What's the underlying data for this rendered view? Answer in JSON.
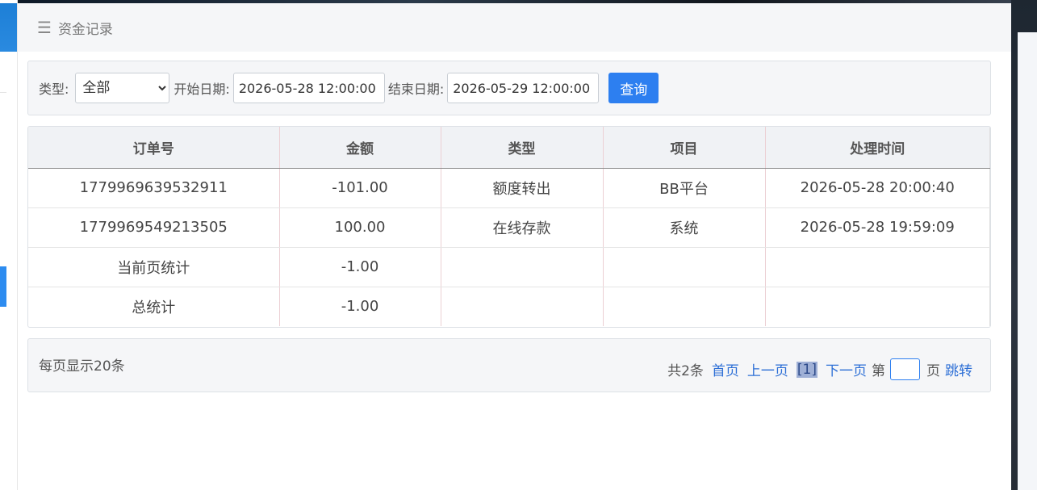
{
  "header": {
    "title": "资金记录",
    "icon": "menu-icon"
  },
  "filter": {
    "type_label": "类型:",
    "type_value": "全部",
    "start_label": "开始日期:",
    "start_value": "2026-05-28 12:00:00",
    "end_label": "结束日期:",
    "end_value": "2026-05-29 12:00:00",
    "query_label": "查询"
  },
  "table": {
    "headers": [
      "订单号",
      "金额",
      "类型",
      "项目",
      "处理时间"
    ],
    "rows": [
      [
        "1779969639532911",
        "-101.00",
        "额度转出",
        "BB平台",
        "2026-05-28 20:00:40"
      ],
      [
        "1779969549213505",
        "100.00",
        "在线存款",
        "系统",
        "2026-05-28 19:59:09"
      ],
      [
        "当前页统计",
        "-1.00",
        "",
        "",
        ""
      ],
      [
        "总统计",
        "-1.00",
        "",
        "",
        ""
      ]
    ]
  },
  "pager": {
    "page_size": "每页显示20条",
    "total": "共2条",
    "first": "首页",
    "prev": "上一页",
    "current": "[1]",
    "next": "下一页",
    "goto_prefix": "第",
    "goto_suffix": "页",
    "jump": "跳转"
  }
}
